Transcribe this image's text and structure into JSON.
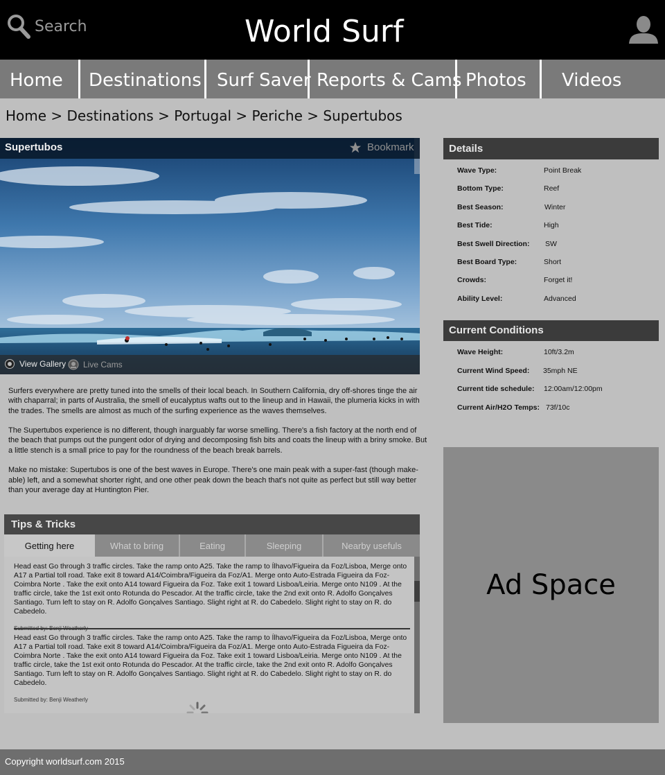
{
  "header": {
    "search_placeholder": "Search",
    "site_title": "World Surf",
    "user_icon": "user-icon",
    "search_icon": "search-icon"
  },
  "nav": {
    "items": [
      {
        "label": "Home"
      },
      {
        "label": "Destinations"
      },
      {
        "label": "Surf Saver"
      },
      {
        "label": "Reports & Cams"
      },
      {
        "label": "Photos"
      },
      {
        "label": "Videos"
      }
    ]
  },
  "breadcrumb": "Home > Destinations > Portugal > Periche > Supertubos",
  "hero": {
    "title": "Supertubos",
    "bookmark_label": "Bookmark",
    "bookmark_icon": "star-icon",
    "view_gallery_label": "View Gallery",
    "view_gallery_icon": "camera-icon",
    "live_cams_label": "Live Cams",
    "live_cams_icon": "webcam-icon"
  },
  "description": {
    "paragraphs": [
      "Surfers everywhere are pretty tuned into the smells of their local beach. In Southern California, dry off-shores tinge the air with chaparral; in parts of Australia, the smell of eucalyptus wafts out to the lineup and in Hawaii, the plumeria kicks in with the trades. The smells are almost as much of the surfing experience as the waves themselves.",
      "The Supertubos experience is no different, though inarguably far worse smelling. There's a fish factory at the north end of the beach that pumps out the pungent odor of drying and decomposing fish bits and coats the lineup with a briny smoke. But a little stench is a small price to pay for the roundness of the beach break barrels.",
      "Make no mistake: Supertubos is one of the best waves in Europe. There's one main peak with a super-fast (though make-able) left, and a somewhat shorter right, and one other peak down the beach that's not quite as perfect but still way better than your average day at Huntington Pier."
    ]
  },
  "tips": {
    "title": "Tips & Tricks",
    "tabs": [
      {
        "label": "Getting here",
        "active": true
      },
      {
        "label": "What to bring",
        "active": false
      },
      {
        "label": "Eating",
        "active": false
      },
      {
        "label": "Sleeping",
        "active": false
      },
      {
        "label": "Nearby usefuls",
        "active": false
      }
    ],
    "entries": [
      {
        "text": "Head east Go through 3 traffic circles. Take the ramp onto A25. Take the ramp to Ílhavo/Figueira da Foz/Lisboa, Merge onto A17 a Partial toll road. Take exit 8 toward A14/Coimbra/Figueira da Foz/A1. Merge onto Auto-Estrada Figueira da Foz- Coimbra Norte . Take the exit onto A14 toward Figueira da Foz. Take exit 1 toward Lisboa/Leiria. Merge onto N109 . At the traffic circle, take the 1st exit onto Rotunda do Pescador. At the traffic circle, take the 2nd exit onto R. Adolfo Gonçalves Santiago. Turn left to stay on R. Adolfo Gonçalves Santiago. Slight right at R. do Cabedelo. Slight right to stay on R. do Cabedelo.",
        "author": "Submitted by: Benji Weatherly"
      },
      {
        "text": "Head east Go through 3 traffic circles. Take the ramp onto A25. Take the ramp to Ílhavo/Figueira da Foz/Lisboa, Merge onto A17 a Partial toll road. Take exit 8 toward A14/Coimbra/Figueira da Foz/A1. Merge onto Auto-Estrada Figueira da Foz- Coimbra Norte . Take the exit onto A14 toward Figueira da Foz. Take exit 1 toward Lisboa/Leiria. Merge onto N109 . At the traffic circle, take the 1st exit onto Rotunda do Pescador. At the traffic circle, take the 2nd exit onto R. Adolfo Gonçalves Santiago. Turn left to stay on R. Adolfo Gonçalves Santiago. Slight right at R. do Cabedelo. Slight right to stay on R. do Cabedelo.",
        "author": "Submitted by: Benji Weatherly"
      }
    ],
    "loading_icon": "loading-spinner-icon"
  },
  "details": {
    "title": "Details",
    "rows": [
      {
        "label": "Wave Type:",
        "value": "Point Break"
      },
      {
        "label": "Bottom Type:",
        "value": "Reef"
      },
      {
        "label": "Best Season:",
        "value": "Winter"
      },
      {
        "label": "Best Tide:",
        "value": "High"
      },
      {
        "label": "Best Swell Direction:",
        "value": "SW"
      },
      {
        "label": "Best Board Type:",
        "value": "Short"
      },
      {
        "label": "Crowds:",
        "value": "Forget it!"
      },
      {
        "label": "Ability Level:",
        "value": "Advanced"
      }
    ]
  },
  "conditions": {
    "title": "Current Conditions",
    "rows": [
      {
        "label": "Wave Height:",
        "value": "10ft/3.2m"
      },
      {
        "label": "Current Wind Speed:",
        "value": "35mph NE"
      },
      {
        "label": "Current tide schedule:",
        "value": "12:00am/12:00pm"
      },
      {
        "label": "Current Air/H2O Temps:",
        "value": "73f/10c"
      }
    ]
  },
  "ad": {
    "label": "Ad Space"
  },
  "footer": {
    "copyright": "Copyright worldsurf.com 2015"
  }
}
